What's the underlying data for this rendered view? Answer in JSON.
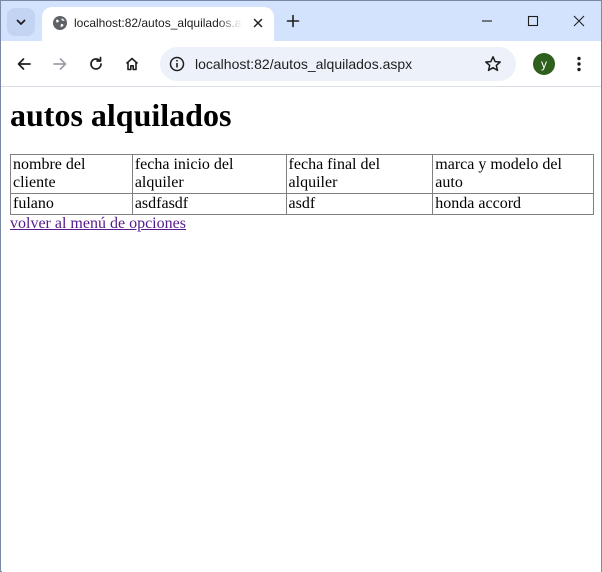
{
  "browser": {
    "tab": {
      "title": "localhost:82/autos_alquilados.aspx"
    },
    "address_bar": {
      "url": "localhost:82/autos_alquilados.aspx"
    },
    "profile": {
      "initial": "y",
      "color": "#2e5f1c"
    }
  },
  "page": {
    "heading": "autos alquilados",
    "table": {
      "headers": [
        "nombre del cliente",
        "fecha inicio del alquiler",
        "fecha final del alquiler",
        "marca y modelo del auto"
      ],
      "rows": [
        [
          "fulano",
          "asdfasdf",
          "asdf",
          "honda accord"
        ]
      ]
    },
    "back_link": "volver al menú de opciones"
  },
  "colors": {
    "tabstrip": "#d3e3fd",
    "omnibox": "#edf2fa",
    "visited_link": "#551a8b"
  }
}
